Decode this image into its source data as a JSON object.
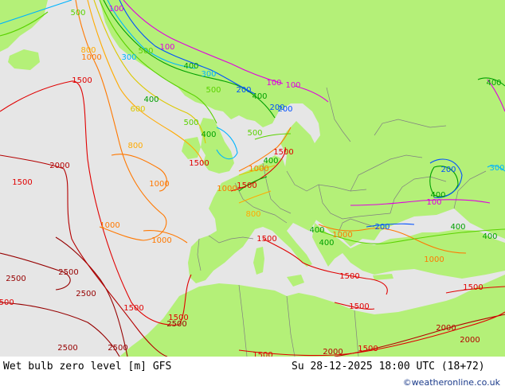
{
  "footer": {
    "title": "Wet bulb zero level [m] GFS",
    "datetime": "Su 28-12-2025 18:00 UTC (18+72)",
    "credit": "©weatheronline.co.uk"
  },
  "colors": {
    "sea": "#e6e6e6",
    "land": "#b4f078",
    "border": "#808080",
    "c100": "#e000e0",
    "c200": "#0050ff",
    "c300": "#00b4ff",
    "c400": "#00a000",
    "c500": "#5ad200",
    "c600": "#dcc800",
    "c800": "#ffaa00",
    "c1000": "#ff7800",
    "c1500": "#e00000",
    "c2000": "#b40000",
    "c2500": "#960000"
  },
  "contour_labels": [
    {
      "text": "100",
      "color": "c100"
    },
    {
      "text": "1500",
      "color": "c1500"
    },
    {
      "text": "500",
      "color": "c500"
    },
    {
      "text": "800",
      "color": "c800"
    },
    {
      "text": "1000",
      "color": "c1000"
    },
    {
      "text": "300",
      "color": "c300"
    },
    {
      "text": "400",
      "color": "c400"
    },
    {
      "text": "500",
      "color": "c500"
    },
    {
      "text": "100",
      "color": "c100"
    },
    {
      "text": "400",
      "color": "c400"
    },
    {
      "text": "300",
      "color": "c300"
    },
    {
      "text": "500",
      "color": "c500"
    },
    {
      "text": "200",
      "color": "c200"
    },
    {
      "text": "100",
      "color": "c100"
    },
    {
      "text": "400",
      "color": "c400"
    },
    {
      "text": "200",
      "color": "c200"
    },
    {
      "text": "600",
      "color": "c600"
    },
    {
      "text": "500",
      "color": "c500"
    },
    {
      "text": "400",
      "color": "c400"
    },
    {
      "text": "800",
      "color": "c800"
    },
    {
      "text": "2000",
      "color": "c2000"
    },
    {
      "text": "1500",
      "color": "c1500"
    },
    {
      "text": "1000",
      "color": "c1000"
    },
    {
      "text": "1000",
      "color": "c1000"
    },
    {
      "text": "1000",
      "color": "c1000"
    },
    {
      "text": "1500",
      "color": "c1500"
    },
    {
      "text": "1500",
      "color": "c1500"
    },
    {
      "text": "400",
      "color": "c400"
    },
    {
      "text": "1500",
      "color": "c1500"
    },
    {
      "text": "2500",
      "color": "c2500"
    },
    {
      "text": "2500",
      "color": "c2500"
    },
    {
      "text": "2500",
      "color": "c2500"
    },
    {
      "text": "1500",
      "color": "c1500"
    },
    {
      "text": "1500",
      "color": "c1500"
    },
    {
      "text": "2500",
      "color": "c2500"
    },
    {
      "text": "2500",
      "color": "c2500"
    },
    {
      "text": "2500",
      "color": "c2500"
    },
    {
      "text": "1500",
      "color": "c1500"
    },
    {
      "text": "1500",
      "color": "c1500"
    },
    {
      "text": "1500",
      "color": "c1500"
    },
    {
      "text": "2000",
      "color": "c2000"
    },
    {
      "text": "2000",
      "color": "c2000"
    },
    {
      "text": "1500",
      "color": "c1500"
    },
    {
      "text": "1000",
      "color": "c1000"
    },
    {
      "text": "1000",
      "color": "c1000"
    },
    {
      "text": "400",
      "color": "c400"
    },
    {
      "text": "400",
      "color": "c400"
    },
    {
      "text": "200",
      "color": "c200"
    },
    {
      "text": "400",
      "color": "c400"
    },
    {
      "text": "100",
      "color": "c100"
    },
    {
      "text": "400",
      "color": "c400"
    },
    {
      "text": "200",
      "color": "c200"
    },
    {
      "text": "300",
      "color": "c300"
    },
    {
      "text": "1500",
      "color": "c1500"
    },
    {
      "text": "1000",
      "color": "c1000"
    },
    {
      "text": "800",
      "color": "c800"
    },
    {
      "text": "1500",
      "color": "c1500"
    },
    {
      "text": "500",
      "color": "c500"
    },
    {
      "text": "400",
      "color": "c400"
    },
    {
      "text": "200",
      "color": "c200"
    },
    {
      "text": "100",
      "color": "c100"
    },
    {
      "text": "1500",
      "color": "c1500"
    },
    {
      "text": "1000",
      "color": "c1000"
    },
    {
      "text": "400",
      "color": "c400"
    },
    {
      "text": "2000",
      "color": "c2000"
    }
  ]
}
